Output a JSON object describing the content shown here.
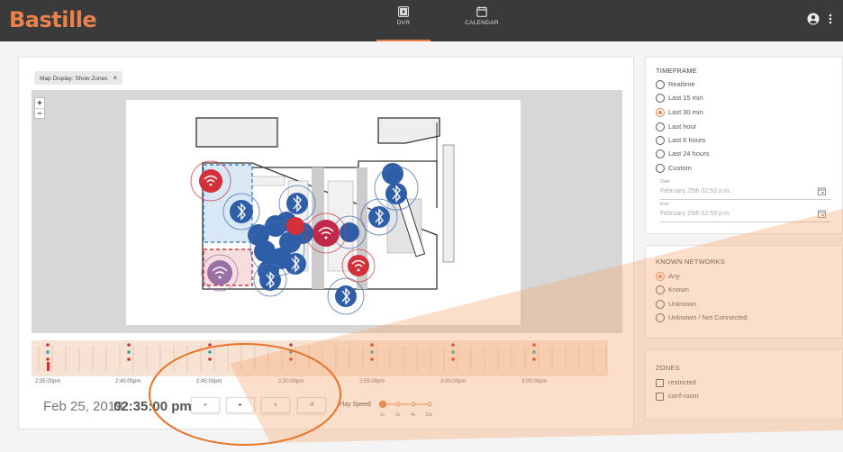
{
  "app": {
    "brand": "Bastille"
  },
  "nav": {
    "tabs": [
      {
        "label": "DVR",
        "icon": "play-icon",
        "active": true
      },
      {
        "label": "CALENDAR",
        "icon": "calendar-icon",
        "active": false
      }
    ]
  },
  "map": {
    "chip_label": "Map Display: Show Zones",
    "chip_close": "×",
    "zoom_in": "+",
    "zoom_out": "−"
  },
  "timeline": {
    "tick_labels": [
      "2:35:00pm",
      "2:40:00pm",
      "2:45:00pm",
      "2:50:00pm",
      "2:55:00pm",
      "3:00:00pm",
      "3:05:00pm"
    ]
  },
  "playback": {
    "date": "Feb 25, 2019",
    "time": "02:35:00 pm",
    "buttons": [
      {
        "name": "skip-back-button",
        "symbol": "«"
      },
      {
        "name": "play-button",
        "symbol": "▸"
      },
      {
        "name": "skip-forward-button",
        "symbol": "»"
      },
      {
        "name": "reset-button",
        "symbol": "↺"
      }
    ],
    "speed_label": "Play Speed",
    "speed_options": [
      "1x",
      "2x",
      "4x",
      "10x"
    ],
    "speed_selected": "1x"
  },
  "timeframe": {
    "title": "TIMEFRAME",
    "options": [
      "Realtime",
      "Last 15 min",
      "Last 30 min",
      "Last hour",
      "Last 6 hours",
      "Last 24 hours",
      "Custom"
    ],
    "selected": "Last 30 min",
    "start_label": "Start",
    "start_value": "February 25th 02:53 p.m.",
    "end_label": "End",
    "end_value": "February 25th 02:53 p.m."
  },
  "known_networks": {
    "title": "KNOWN NETWORKS",
    "options": [
      "Any",
      "Known",
      "Unknown",
      "Unknown / Not Connected"
    ],
    "selected": "Any"
  },
  "zones": {
    "title": "ZONES",
    "options": [
      "restricted",
      "conf-room"
    ]
  },
  "colors": {
    "accent": "#e8824a",
    "topbar": "#3a3a3a",
    "bluetooth": "#2f5ea8",
    "wifi": "#d4303a",
    "wifi_purple": "#9a6fa6"
  }
}
